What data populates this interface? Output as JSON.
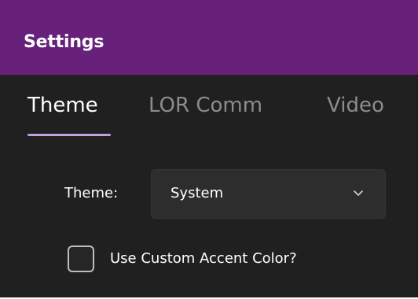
{
  "window": {
    "title": "Settings"
  },
  "tabs": [
    {
      "label": "Theme",
      "selected": true
    },
    {
      "label": "LOR Comm",
      "selected": false
    },
    {
      "label": "Video",
      "selected": false
    }
  ],
  "theme_setting": {
    "label": "Theme:",
    "selected_value": "System",
    "icon": "chevron-down-icon"
  },
  "accent_setting": {
    "label": "Use Custom Accent Color?",
    "checked": false
  },
  "colors": {
    "titlebar": "#68217a",
    "background": "#202020",
    "tab_indicator": "#c59de0",
    "inactive_tab_text": "#8c8c8c",
    "control_background": "#2d2d2d"
  }
}
